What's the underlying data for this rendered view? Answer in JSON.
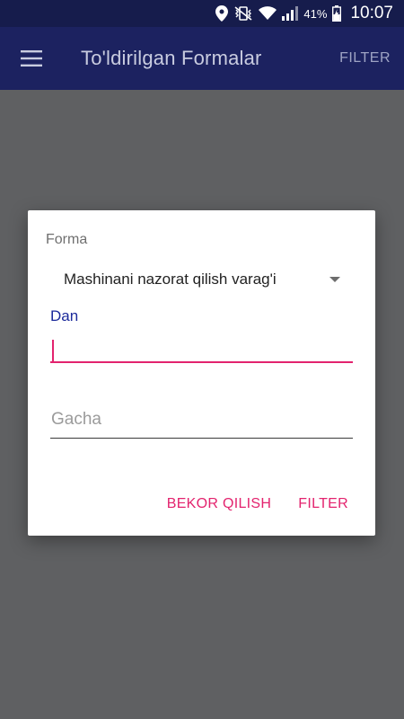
{
  "status_bar": {
    "battery_percent": "41%",
    "time": "10:07",
    "icons": [
      "location-icon",
      "vibrate-icon",
      "wifi-icon",
      "signal-icon",
      "battery-charging-icon"
    ]
  },
  "app_bar": {
    "menu_icon": "hamburger-menu-icon",
    "title": "To'ldirilgan Formalar",
    "filter_label": "FILTER"
  },
  "dialog": {
    "forma_label": "Forma",
    "forma_selected": "Mashinani nazorat qilish varag'i",
    "dan_label": "Dan",
    "dan_value": "",
    "gacha_placeholder": "Gacha",
    "cancel_label": "BEKOR QILISH",
    "filter_label": "FILTER"
  },
  "colors": {
    "app_bar": "#1c2260",
    "status_bar": "#161c4c",
    "accent": "#e3236e",
    "focused_label": "#1c2a9b",
    "scrim": "#5f6062"
  }
}
